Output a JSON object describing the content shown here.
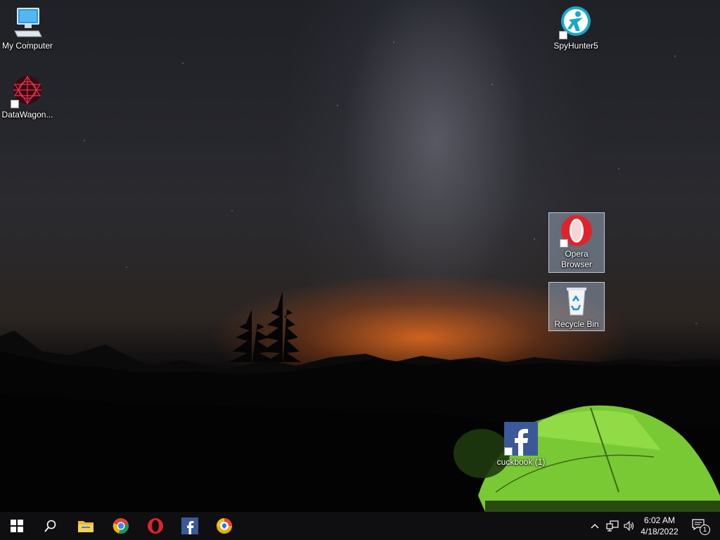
{
  "desktop": {
    "icons": [
      {
        "label": "My Computer",
        "icon": "computer-icon"
      },
      {
        "label": "DataWagon...",
        "icon": "datawagon-icon"
      },
      {
        "label": "SpyHunter5",
        "icon": "spyhunter-icon"
      },
      {
        "label": "Opera Browser",
        "icon": "opera-icon"
      },
      {
        "label": "Recycle Bin",
        "icon": "recycle-bin-icon"
      },
      {
        "label": "cuckbook (1)",
        "icon": "facebook-icon"
      }
    ]
  },
  "taskbar": {
    "start": {
      "icon": "windows-logo-icon"
    },
    "search": {
      "icon": "search-icon"
    },
    "pinned": [
      {
        "name": "File Explorer",
        "icon": "folder-icon"
      },
      {
        "name": "Google Chrome",
        "icon": "chrome-icon"
      },
      {
        "name": "Opera",
        "icon": "opera-icon"
      },
      {
        "name": "Facebook",
        "icon": "facebook-icon"
      },
      {
        "name": "Browser",
        "icon": "shield-browser-icon"
      }
    ],
    "tray": {
      "time": "6:02 AM",
      "date": "4/18/2022",
      "notification_count": "1"
    }
  },
  "colors": {
    "taskbar_bg": "#0f0f12",
    "opera_red": "#e0232b",
    "facebook_blue": "#3b5998",
    "tent_green": "#7bd13a"
  }
}
